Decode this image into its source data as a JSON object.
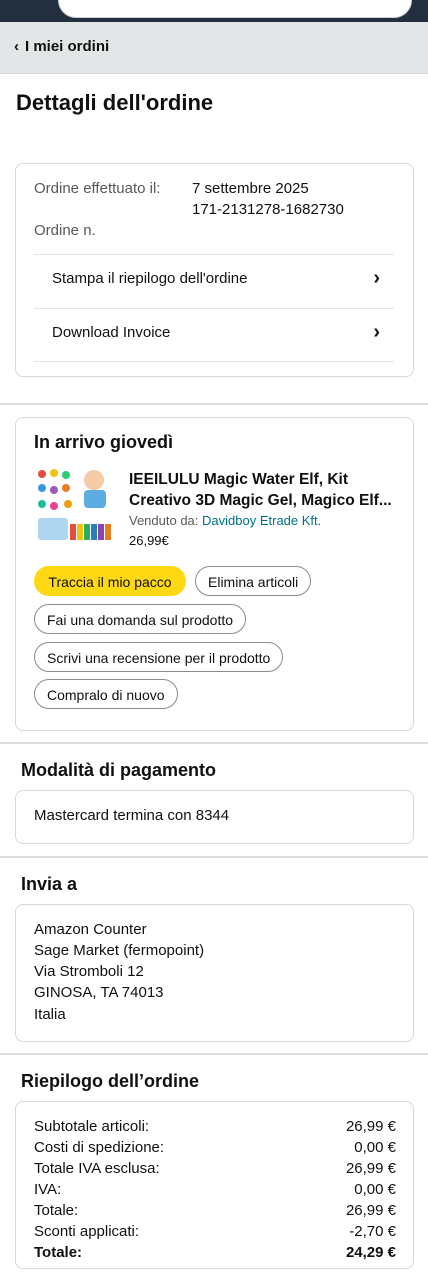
{
  "header": {
    "back_label": "I miei ordini"
  },
  "page_title": "Dettagli dell'ordine",
  "order": {
    "placed_label": "Ordine effettuato il:",
    "placed_value": "7 settembre 2025",
    "number_label": "Ordine n.",
    "number_value": "171-2131278-1682730",
    "links": [
      {
        "label": "Stampa il riepilogo dell'ordine"
      },
      {
        "label": "Download Invoice"
      }
    ]
  },
  "shipment": {
    "status": "In arrivo giovedì",
    "product_title": "IEEILULU Magic Water Elf, Kit Creativo 3D Magic Gel, Magico Elf...",
    "sold_by_label": "Venduto da:",
    "seller": "Davidboy Etrade Kft.",
    "price": "26,99€",
    "buttons": {
      "track": "Traccia il mio pacco",
      "delete": "Elimina articoli",
      "ask": "Fai una domanda sul prodotto",
      "review": "Scrivi una recensione per il prodotto",
      "rebuy": "Compralo di nuovo"
    }
  },
  "payment": {
    "title": "Modalità di pagamento",
    "method": "Mastercard termina con 8344"
  },
  "ship_to": {
    "title": "Invia a",
    "lines": [
      "Amazon Counter",
      "Sage Market (fermopoint)",
      "Via Stromboli 12",
      "GINOSA, TA 74013",
      "Italia"
    ]
  },
  "summary": {
    "title": "Riepilogo dell’ordine",
    "rows": [
      {
        "k": "Subtotale articoli:",
        "v": "26,99 €"
      },
      {
        "k": "Costi di spedizione:",
        "v": "0,00 €"
      },
      {
        "k": "Totale IVA esclusa:",
        "v": "26,99 €"
      },
      {
        "k": "IVA:",
        "v": "0,00 €"
      },
      {
        "k": "Totale:",
        "v": "26,99 €"
      },
      {
        "k": "Sconti applicati:",
        "v": "-2,70 €"
      },
      {
        "k": "Totale:",
        "v": "24,29 €"
      }
    ]
  },
  "colors": {
    "accent_button": "#ffd814",
    "link": "#007185",
    "topbar": "#232f3e"
  }
}
